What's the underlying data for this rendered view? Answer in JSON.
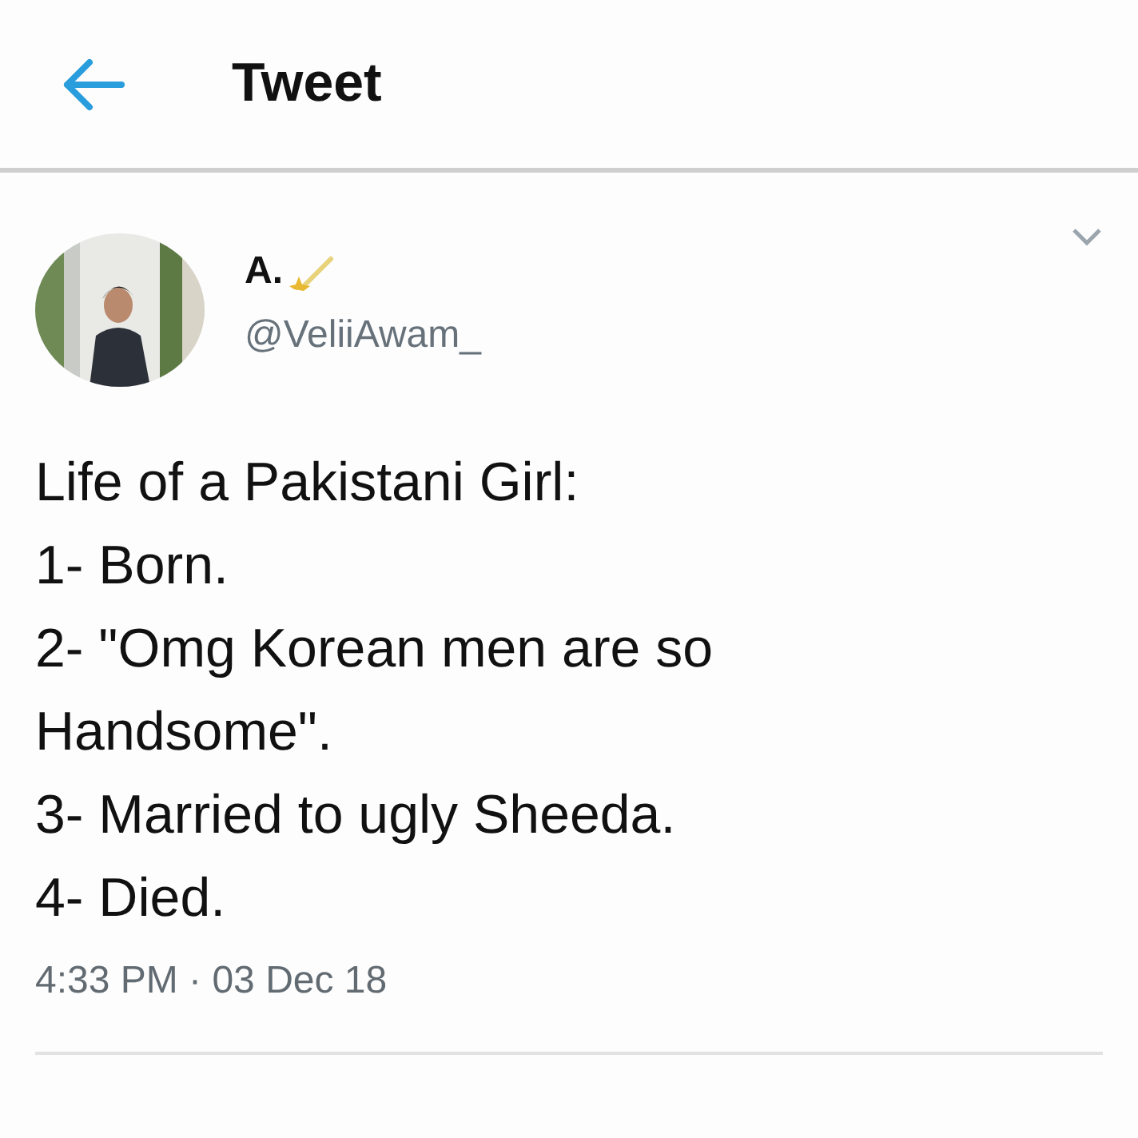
{
  "header": {
    "title": "Tweet"
  },
  "tweet": {
    "name": "A.",
    "handle": "@VeliiAwam_",
    "lines": [
      "Life of a Pakistani Girl:",
      "1- Born.",
      "2- \"Omg Korean men are so Handsome\".",
      "3- Married to ugly Sheeda.",
      "4- Died."
    ],
    "timestamp": "4:33 PM · 03 Dec 18"
  }
}
